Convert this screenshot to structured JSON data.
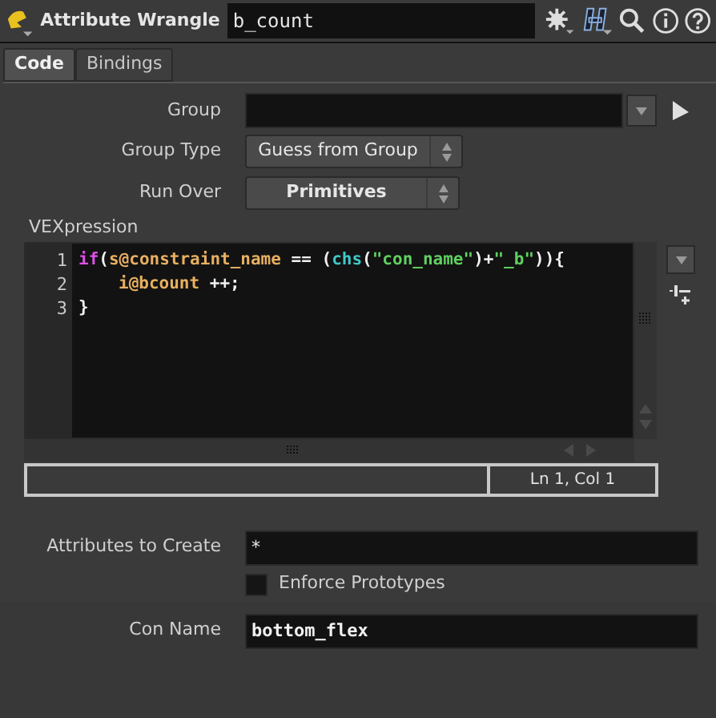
{
  "header": {
    "node_type": "Attribute Wrangle",
    "node_name": "b_count"
  },
  "tabs": [
    {
      "label": "Code",
      "selected": true
    },
    {
      "label": "Bindings",
      "selected": false
    }
  ],
  "group": {
    "label": "Group"
  },
  "group_type": {
    "label": "Group Type",
    "value": "Guess from Group",
    "bold": false
  },
  "run_over": {
    "label": "Run Over",
    "value": "Primitives",
    "bold": true
  },
  "vexpression": {
    "label": "VEXpression",
    "lines": [
      {
        "number": "1",
        "indented": false,
        "tokens": [
          {
            "kind": "keyword",
            "text": "if"
          },
          {
            "kind": "plain",
            "text": "("
          },
          {
            "kind": "attr",
            "text": "s@constraint_name"
          },
          {
            "kind": "plain",
            "text": " == ("
          },
          {
            "kind": "func",
            "text": "chs"
          },
          {
            "kind": "plain",
            "text": "("
          },
          {
            "kind": "string",
            "text": "\"con_name\""
          },
          {
            "kind": "plain",
            "text": ")+"
          },
          {
            "kind": "string",
            "text": "\"_b\""
          },
          {
            "kind": "plain",
            "text": ")){"
          }
        ]
      },
      {
        "number": "2",
        "indented": true,
        "tokens": [
          {
            "kind": "attr",
            "text": "i@bcount"
          },
          {
            "kind": "plain",
            "text": " ++;"
          }
        ]
      },
      {
        "number": "3",
        "indented": false,
        "tokens": [
          {
            "kind": "plain",
            "text": "}"
          }
        ]
      }
    ],
    "cursor_position": "Ln 1, Col 1"
  },
  "attributes_to_create": {
    "label": "Attributes to Create",
    "value": "*"
  },
  "enforce_prototypes": {
    "label": "Enforce Prototypes",
    "checked": false
  },
  "con_name": {
    "label": "Con Name",
    "value": "bottom_flex"
  }
}
